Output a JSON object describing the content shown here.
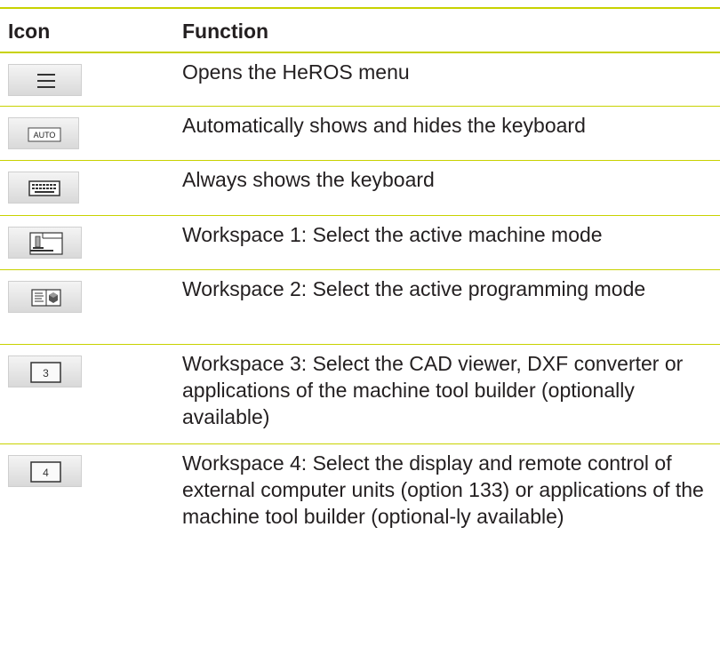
{
  "table": {
    "header": {
      "icon": "Icon",
      "function": "Function"
    },
    "rows": [
      {
        "icon": "menu-icon",
        "function": "Opens the HeROS menu"
      },
      {
        "icon": "auto-keyboard-icon",
        "icon_text": "AUTO",
        "function": "Automatically shows and hides the keyboard"
      },
      {
        "icon": "keyboard-icon",
        "function": "Always shows the keyboard"
      },
      {
        "icon": "machine-mode-icon",
        "function": "Workspace 1: Select the active machine mode"
      },
      {
        "icon": "programming-mode-icon",
        "function": "Workspace 2: Select the active programming mode"
      },
      {
        "icon": "workspace-3-icon",
        "icon_text": "3",
        "function": "Workspace 3: Select the CAD viewer, DXF converter or applications of the machine tool builder (optionally available)"
      },
      {
        "icon": "workspace-4-icon",
        "icon_text": "4",
        "function": "Workspace 4: Select the display and remote control of external computer units (option 133) or applications of the machine tool builder (optional-ly available)"
      }
    ]
  },
  "colors": {
    "rule": "#c8d200",
    "text": "#231f20",
    "button_top": "#f4f4f4",
    "button_bottom": "#d9d9d9"
  }
}
